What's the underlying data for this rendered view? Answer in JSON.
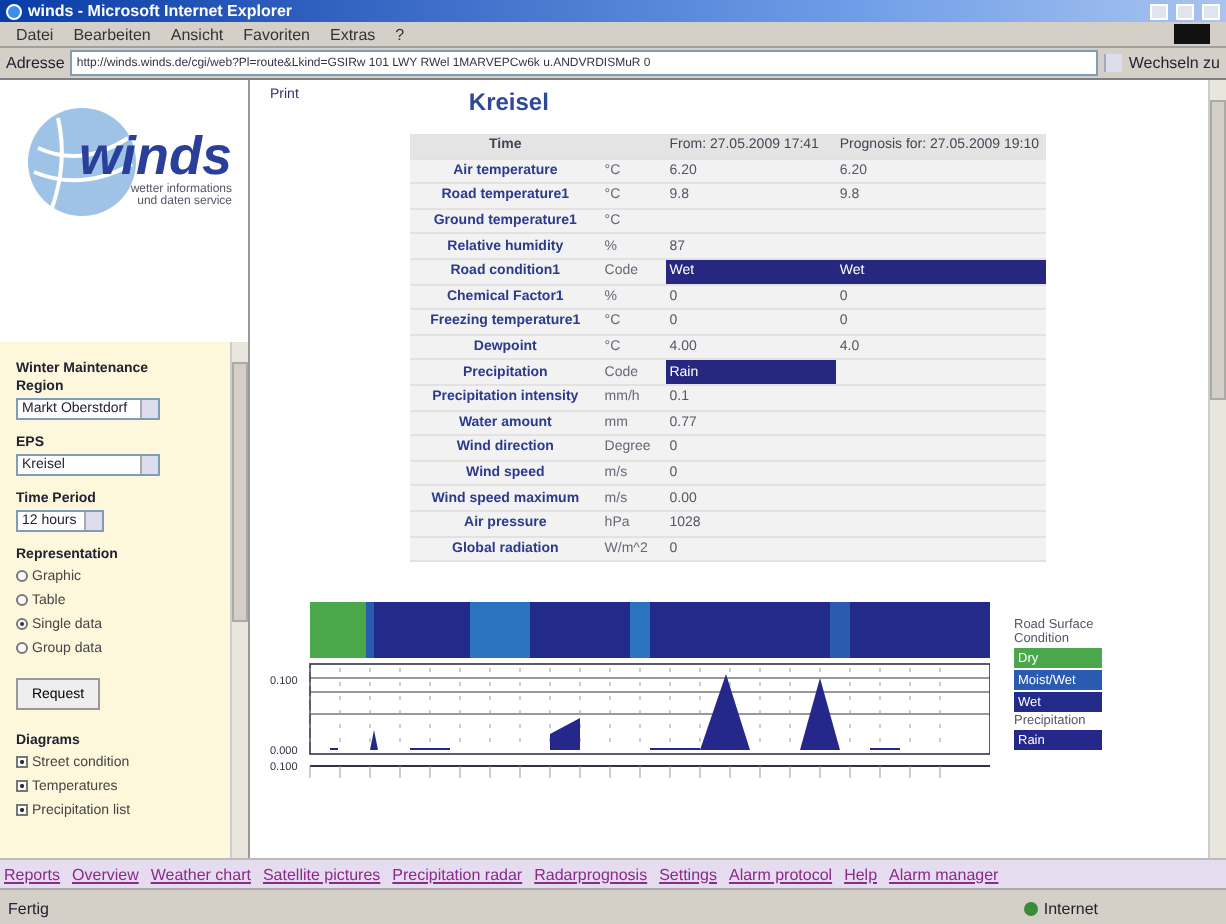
{
  "window": {
    "title": "winds - Microsoft Internet Explorer"
  },
  "menu": [
    "Datei",
    "Bearbeiten",
    "Ansicht",
    "Favoriten",
    "Extras",
    "?"
  ],
  "address_bar": {
    "label": "Adresse",
    "value": "http://winds.winds.de/cgi/web?Pl=route&Lkind=GSIRw 101 LWY RWel 1MARVEPCw6k u.ANDVRDISMuR 0",
    "go": "Wechseln zu"
  },
  "logo": {
    "name": "winds",
    "tagline": [
      "wetter informations",
      "und daten service"
    ]
  },
  "sidebar": {
    "heading": "Winter Maintenance",
    "fields": [
      {
        "label": "Region",
        "value": "Markt Oberstdorf"
      },
      {
        "label": "EPS",
        "value": "Kreisel"
      },
      {
        "label": "Time Period",
        "value": "12 hours"
      }
    ],
    "representation": {
      "label": "Representation",
      "options": [
        {
          "label": "Graphic",
          "selected": false
        },
        {
          "label": "Table",
          "selected": false
        },
        {
          "label": "Single data",
          "selected": true
        },
        {
          "label": "Group data",
          "selected": false
        }
      ]
    },
    "button": "Request",
    "diagrams": {
      "label": "Diagrams",
      "options": [
        {
          "label": "Street condition",
          "checked": true
        },
        {
          "label": "Temperatures",
          "checked": true
        },
        {
          "label": "Precipitation list",
          "checked": true
        }
      ]
    }
  },
  "main": {
    "print": "Print",
    "title": "Kreisel",
    "table": {
      "columns": [
        "Time",
        "",
        "From: 27.05.2009 17:41",
        "Prognosis for: 27.05.2009 19:10"
      ],
      "rows": [
        {
          "label": "Air temperature",
          "unit": "°C",
          "values": [
            {
              "text": "6.20",
              "highlighted": false
            },
            {
              "text": "6.20",
              "highlighted": false
            }
          ]
        },
        {
          "label": "Road temperature1",
          "unit": "°C",
          "values": [
            {
              "text": "9.8",
              "highlighted": false
            },
            {
              "text": "9.8",
              "highlighted": false
            }
          ]
        },
        {
          "label": "Ground temperature1",
          "unit": "°C"
        },
        {
          "label": "Relative humidity",
          "unit": "%",
          "values": [
            {
              "text": "87",
              "highlighted": false
            }
          ]
        },
        {
          "label": "Road condition1",
          "unit": "Code",
          "values": [
            {
              "text": "Wet",
              "highlighted": true
            },
            {
              "text": "Wet",
              "highlighted": true
            }
          ]
        },
        {
          "label": "Chemical Factor1",
          "unit": "%",
          "values": [
            {
              "text": "0",
              "highlighted": false
            },
            {
              "text": "0",
              "highlighted": false
            }
          ]
        },
        {
          "label": "Freezing temperature1",
          "unit": "°C",
          "values": [
            {
              "text": "0",
              "highlighted": false
            },
            {
              "text": "0",
              "highlighted": false
            }
          ]
        },
        {
          "label": "Dewpoint",
          "unit": "°C",
          "values": [
            {
              "text": "4.00",
              "highlighted": false
            },
            {
              "text": "4.0",
              "highlighted": false
            }
          ]
        },
        {
          "label": "Precipitation",
          "unit": "Code",
          "values": [
            {
              "text": "Rain",
              "highlighted": true
            }
          ]
        },
        {
          "label": "Precipitation intensity",
          "unit": "mm/h",
          "values": [
            {
              "text": "0.1",
              "highlighted": false
            }
          ]
        },
        {
          "label": "Water amount",
          "unit": "mm",
          "values": [
            {
              "text": "0.77",
              "highlighted": false
            }
          ]
        },
        {
          "label": "Wind direction",
          "unit": "Degree",
          "values": [
            {
              "text": "0",
              "highlighted": false
            }
          ]
        },
        {
          "label": "Wind speed",
          "unit": "m/s",
          "values": [
            {
              "text": "0",
              "highlighted": false
            }
          ]
        },
        {
          "label": "Wind speed maximum",
          "unit": "m/s",
          "values": [
            {
              "text": "0.00",
              "highlighted": false
            }
          ]
        },
        {
          "label": "Air pressure",
          "unit": "hPa",
          "values": [
            {
              "text": "1028",
              "highlighted": false
            }
          ]
        },
        {
          "label": "Global radiation",
          "unit": "W/m^2",
          "values": [
            {
              "text": "0",
              "highlighted": false
            }
          ]
        }
      ]
    },
    "chart": {
      "y_labels": [
        "0.100",
        "0.000",
        "0.100"
      ]
    },
    "legend": [
      {
        "kind": "heading",
        "text": "Road Surface Condition"
      },
      {
        "kind": "swatch",
        "text": "Dry",
        "color": "#4aa84a"
      },
      {
        "kind": "swatch",
        "text": "Moist/Wet",
        "color": "#2b5bb0"
      },
      {
        "kind": "swatch",
        "text": "Wet",
        "color": "#222a8a"
      },
      {
        "kind": "heading",
        "text": "Precipitation"
      },
      {
        "kind": "swatch",
        "text": "Rain",
        "color": "#25278a"
      }
    ]
  },
  "nav_links": [
    "Reports",
    "Overview",
    "Weather chart",
    "Satellite pictures",
    "Precipitation radar",
    "Radarprognosis",
    "Settings",
    "Alarm protocol",
    "Help",
    "Alarm manager"
  ],
  "status_bar": {
    "text": "Fertig",
    "zone": "Internet"
  }
}
